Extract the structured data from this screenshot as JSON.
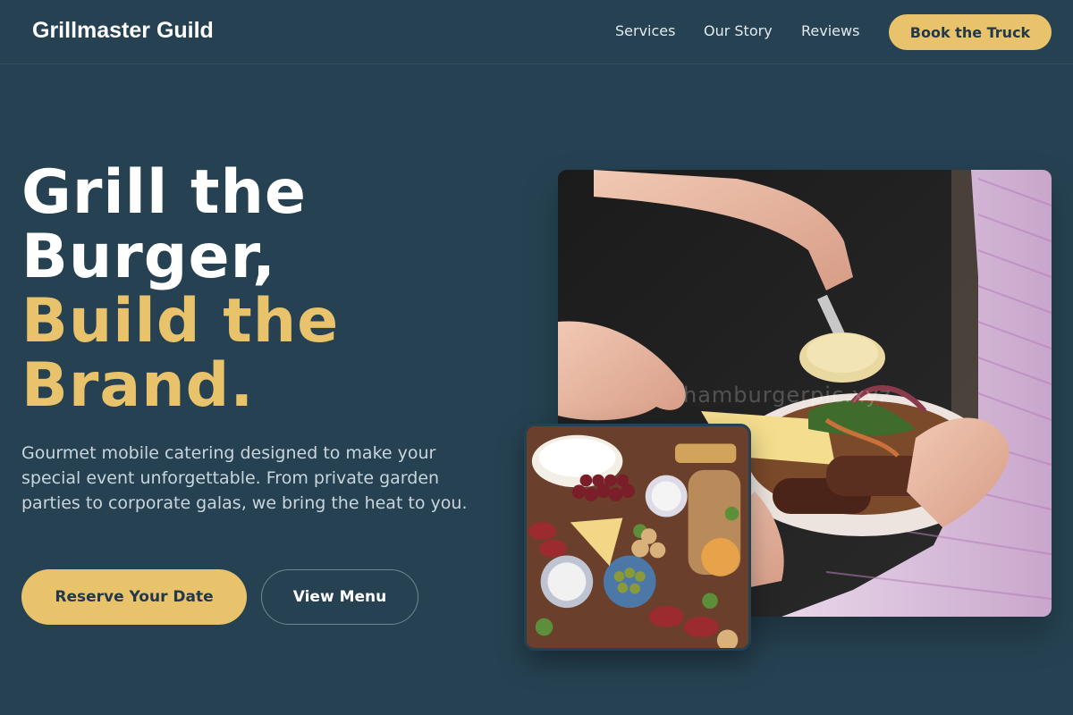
{
  "header": {
    "brand": "Grillmaster Guild",
    "nav": {
      "services": "Services",
      "our_story": "Our Story",
      "reviews": "Reviews"
    },
    "cta": "Book the Truck"
  },
  "hero": {
    "headline": {
      "line1": "Grill the",
      "line2": "Burger,",
      "line3": "Build the",
      "line4": "Brand."
    },
    "subtext": "Gourmet mobile catering designed to make your special event unforgettable. From private garden parties to corporate galas, we bring the heat to you.",
    "primary_button": "Reserve Your Date",
    "secondary_button": "View Menu"
  },
  "images": {
    "main_photo_watermark": "hamburgerpic.xyz"
  },
  "colors": {
    "background": "#264252",
    "accent": "#e8c36b",
    "text_primary": "#ffffff",
    "text_muted": "#c9d5dc"
  }
}
